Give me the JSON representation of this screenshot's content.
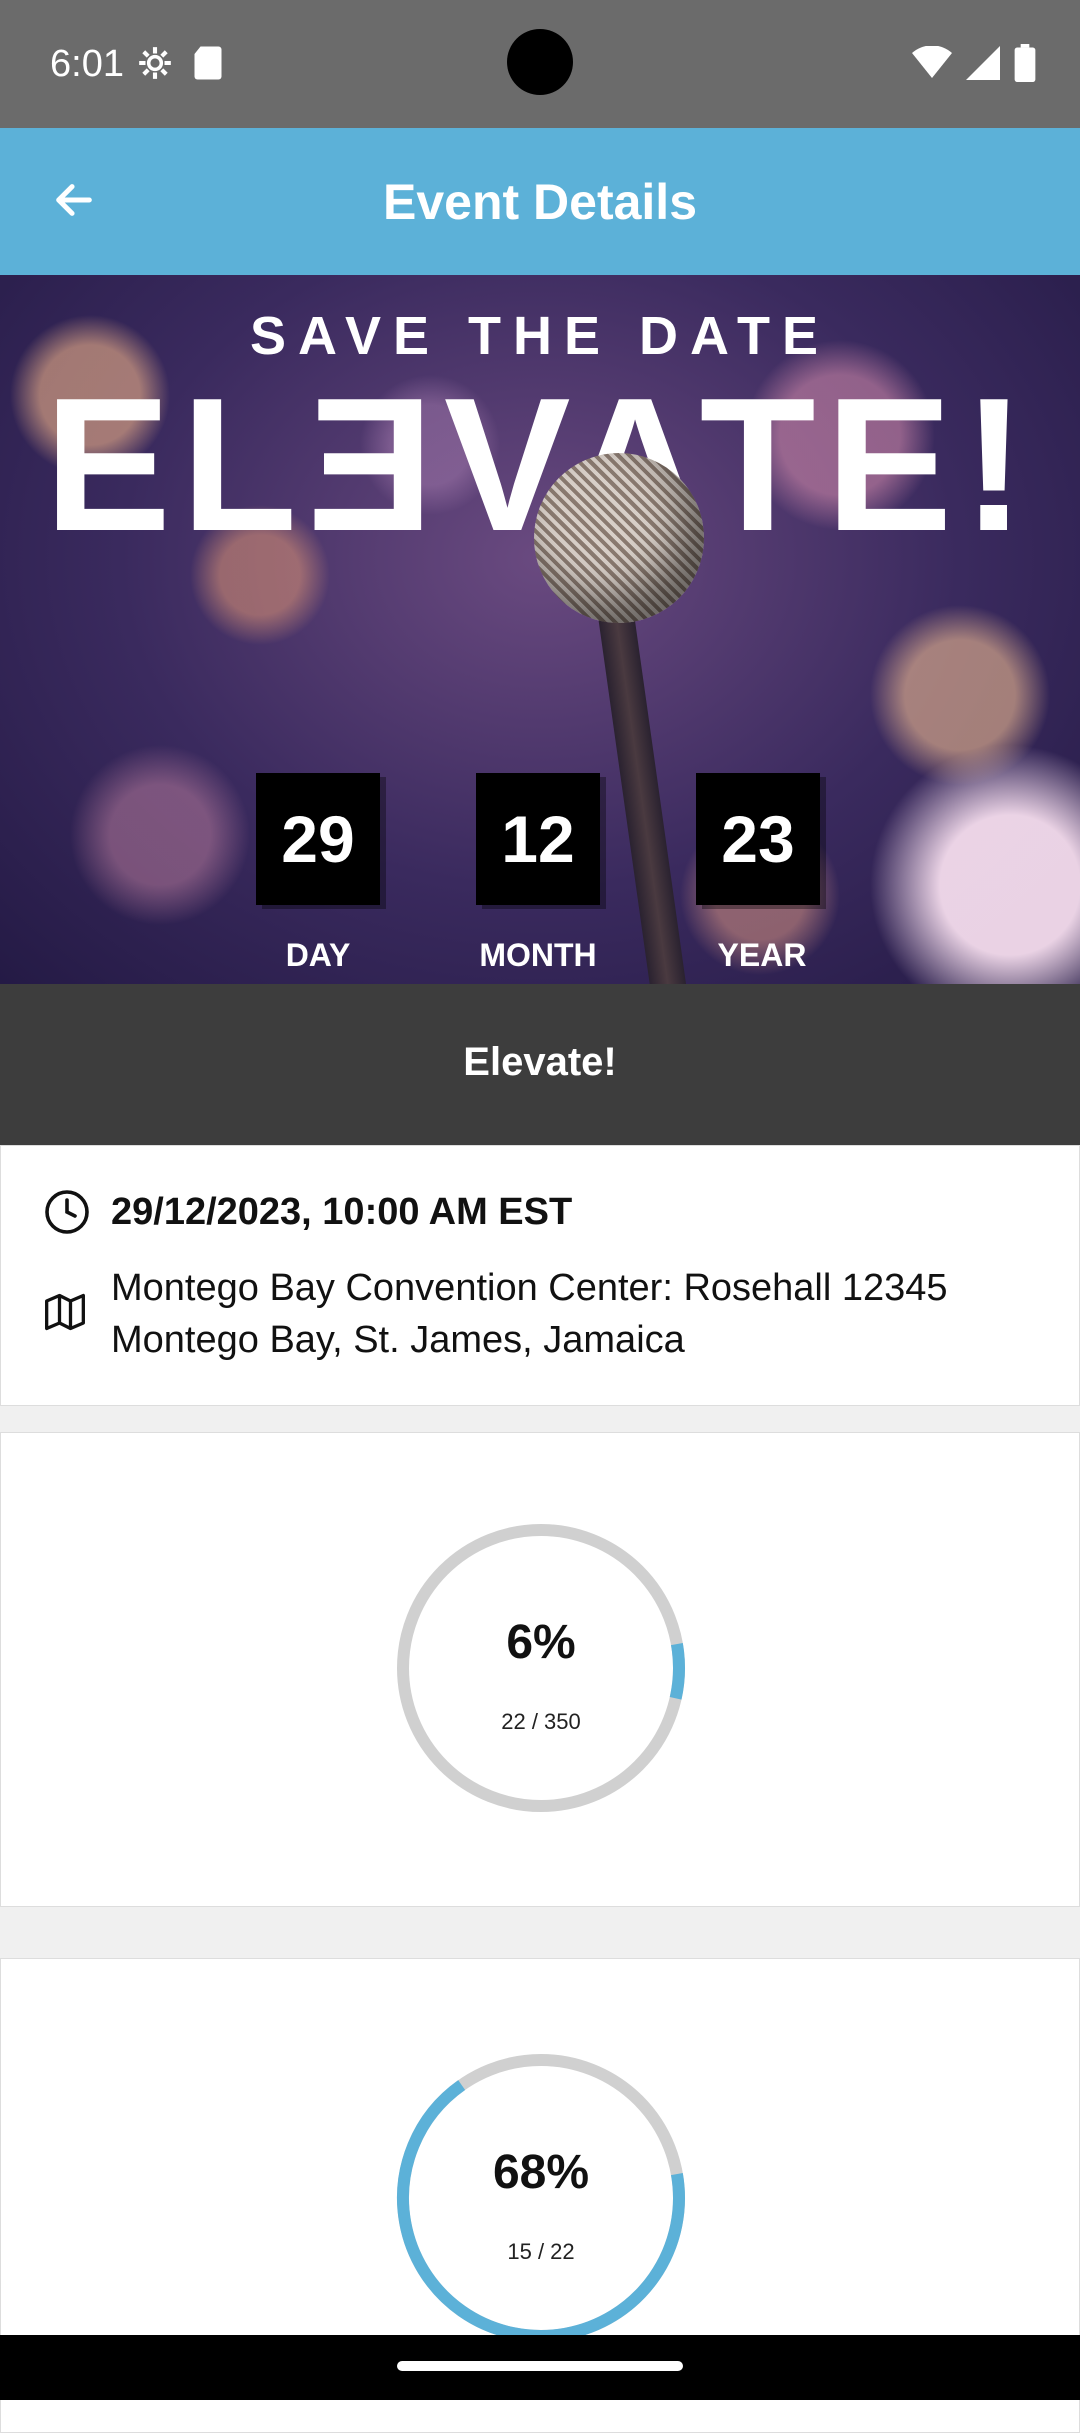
{
  "status_bar": {
    "time": "6:01",
    "left_icons": [
      "settings-icon",
      "sd-card-icon"
    ],
    "right_icons": [
      "wifi-icon",
      "signal-icon",
      "battery-icon"
    ]
  },
  "app_bar": {
    "title": "Event Details",
    "back_icon": "arrow-left-icon"
  },
  "hero": {
    "headline": "SAVE THE DATE",
    "event_logo_text": "ELƎVATE!",
    "date": [
      {
        "value": "29",
        "label": "DAY"
      },
      {
        "value": "12",
        "label": "MONTH"
      },
      {
        "value": "23",
        "label": "YEAR"
      }
    ]
  },
  "event": {
    "name": "Elevate!",
    "datetime": "29/12/2023, 10:00 AM EST",
    "location_line1": "Montego Bay Convention Center: Rosehall 12345",
    "location_line2": "Montego Bay, St. James, Jamaica",
    "datetime_icon": "clock-icon",
    "location_icon": "map-icon"
  },
  "progress": [
    {
      "percent_label": "6%",
      "count_label": "22 / 350",
      "fraction": 0.063
    },
    {
      "percent_label": "68%",
      "count_label": "15 / 22",
      "fraction": 0.68
    }
  ],
  "colors": {
    "accent": "#5cb1d8",
    "ring_track": "#d0d0d0",
    "event_bar": "#3d3d3d"
  }
}
